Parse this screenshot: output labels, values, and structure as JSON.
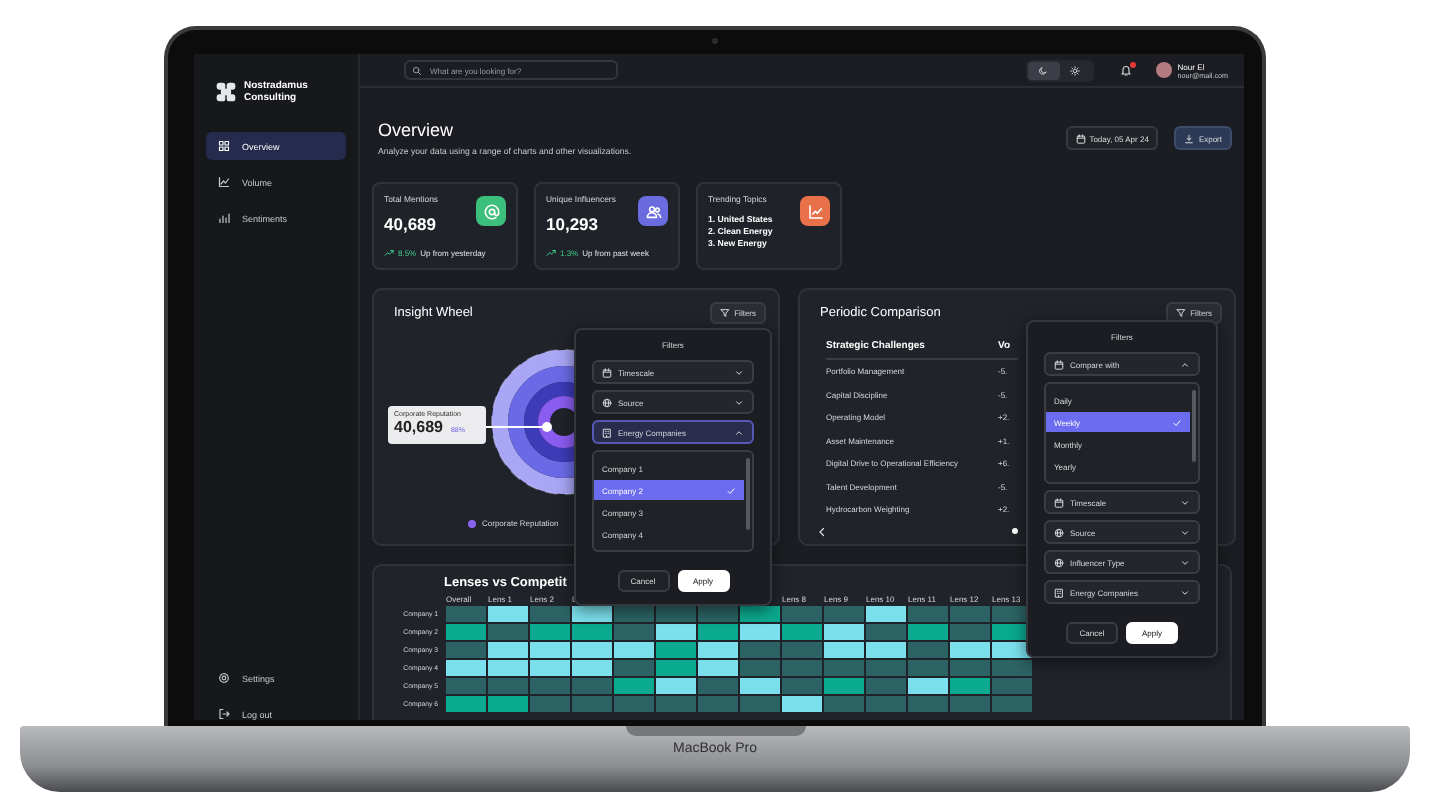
{
  "laptop": {
    "label": "MacBook Pro"
  },
  "sidebar": {
    "brand": [
      "Nostradamus",
      "Consulting"
    ],
    "nav": [
      {
        "label": "Overview",
        "selected": true
      },
      {
        "label": "Volume",
        "selected": false
      },
      {
        "label": "Sentiments",
        "selected": false
      }
    ],
    "footer": [
      {
        "label": "Settings"
      },
      {
        "label": "Log out"
      }
    ]
  },
  "header": {
    "search": {
      "placeholder": "What are you looking for?"
    },
    "theme_toggle": [
      {
        "selected": true
      },
      {
        "selected": false
      }
    ],
    "notification": {
      "unread": true
    },
    "user": {
      "name": "Nour El",
      "email": "nour@mail.com"
    }
  },
  "page": {
    "title": "Overview",
    "subtitle": "Analyze your data using a range of charts and other visualizations.",
    "date_button": "Today, 05 Apr 24",
    "export_button": "Export"
  },
  "stats": [
    {
      "kind": "metric",
      "title": "Total Mentions",
      "value": "40,689",
      "change": "8.5%",
      "note": "Up from yesterday",
      "color": "#3dbf7c"
    },
    {
      "kind": "metric",
      "title": "Unique Influencers",
      "value": "10,293",
      "change": "1.3%",
      "note": "Up from past week",
      "color": "#6b6be0"
    },
    {
      "kind": "list",
      "title": "Trending Topics",
      "items": [
        "1. United States",
        "2. Clean Energy",
        "3. New Energy"
      ],
      "color": "#e8714a"
    }
  ],
  "insight_wheel": {
    "title": "Insight Wheel",
    "filters_button": "Filters",
    "tooltip": {
      "label": "Corporate Reputation",
      "value": "40,689",
      "percent": "88%"
    },
    "legend": [
      {
        "label": "Corporate Reputation",
        "color": "#8b63f0"
      }
    ],
    "filters_popup": {
      "title": "Filters",
      "fields": [
        {
          "kind": "date",
          "label": "Timescale",
          "focused": false,
          "expanded": false
        },
        {
          "kind": "source",
          "label": "Source",
          "focused": false,
          "expanded": false
        },
        {
          "kind": "company",
          "label": "Energy Companies",
          "focused": true,
          "expanded": true,
          "options": [
            {
              "label": "Company 1",
              "selected": false
            },
            {
              "label": "Company 2",
              "selected": true
            },
            {
              "label": "Company 3",
              "selected": false
            },
            {
              "label": "Company 4",
              "selected": false
            }
          ]
        }
      ],
      "cancel": "Cancel",
      "apply": "Apply"
    }
  },
  "periodic_comparison": {
    "title": "Periodic Comparison",
    "filters_button": "Filters",
    "columns": [
      "Strategic Challenges",
      "Vo"
    ],
    "rows": [
      {
        "name": "Portfolio Management",
        "value": "-5."
      },
      {
        "name": "Capital Discipline",
        "value": "-5."
      },
      {
        "name": "Operating Model",
        "value": "+2."
      },
      {
        "name": "Asset Maintenance",
        "value": "+1."
      },
      {
        "name": "Digital Drive to Operational Efficiency",
        "value": "+6."
      },
      {
        "name": "Talent Development",
        "value": "-5."
      },
      {
        "name": "Hydrocarbon Weighting",
        "value": "+2."
      }
    ],
    "filters_popup": {
      "title": "Filters",
      "fields": [
        {
          "kind": "date",
          "label": "Compare with",
          "focused": false,
          "expanded": true,
          "options": [
            {
              "label": "Daily",
              "selected": false
            },
            {
              "label": "Weekly",
              "selected": true
            },
            {
              "label": "Monthly",
              "selected": false
            },
            {
              "label": "Yearly",
              "selected": false
            }
          ]
        },
        {
          "kind": "date",
          "label": "Timescale",
          "focused": false,
          "expanded": false
        },
        {
          "kind": "source",
          "label": "Source",
          "focused": false,
          "expanded": false
        },
        {
          "kind": "source",
          "label": "Influencer Type",
          "focused": false,
          "expanded": false
        },
        {
          "kind": "company",
          "label": "Energy Companies",
          "focused": false,
          "expanded": false
        }
      ],
      "cancel": "Cancel",
      "apply": "Apply"
    }
  },
  "lenses": {
    "title": "Lenses vs Competit",
    "columns": [
      {
        "label": "Overall"
      },
      {
        "label": "Lens 1"
      },
      {
        "label": "Lens 2"
      },
      {
        "label": "L"
      },
      {},
      {},
      {},
      {},
      {
        "label": "Lens 8"
      },
      {
        "label": "Lens 9"
      },
      {
        "label": "Lens 10"
      },
      {
        "label": "Lens 11"
      },
      {
        "label": "Lens 12"
      },
      {
        "label": "Lens 13"
      }
    ],
    "rows": [
      {
        "label": "Company 1",
        "cells": [
          {
            "color": "#2c6364"
          },
          {
            "color": "#7be0ec"
          },
          {
            "color": "#2c6364"
          },
          {
            "color": "#7be0ec"
          },
          {
            "color": "#2c6364"
          },
          {
            "color": "#2c6364"
          },
          {
            "color": "#2c6364"
          },
          {
            "color": "#0aaa90"
          },
          {
            "color": "#2c6364"
          },
          {
            "color": "#2c6364"
          },
          {
            "color": "#7be0ec"
          },
          {
            "color": "#2c6364"
          },
          {
            "color": "#2c6364"
          },
          {
            "color": "#2c6364"
          }
        ]
      },
      {
        "label": "Company 2",
        "cells": [
          {
            "color": "#0aaa90"
          },
          {
            "color": "#2c6364"
          },
          {
            "color": "#0aaa90"
          },
          {
            "color": "#0aaa90"
          },
          {
            "color": "#2c6364"
          },
          {
            "color": "#7be0ec"
          },
          {
            "color": "#0aaa90"
          },
          {
            "color": "#7be0ec"
          },
          {
            "color": "#0aaa90"
          },
          {
            "color": "#7be0ec"
          },
          {
            "color": "#2c6364"
          },
          {
            "color": "#0aaa90"
          },
          {
            "color": "#2c6364"
          },
          {
            "color": "#0aaa90"
          }
        ]
      },
      {
        "label": "Company 3",
        "cells": [
          {
            "color": "#2c6364"
          },
          {
            "color": "#7be0ec"
          },
          {
            "color": "#7be0ec"
          },
          {
            "color": "#7be0ec"
          },
          {
            "color": "#7be0ec"
          },
          {
            "color": "#0aaa90"
          },
          {
            "color": "#7be0ec"
          },
          {
            "color": "#2c6364"
          },
          {
            "color": "#2c6364"
          },
          {
            "color": "#7be0ec"
          },
          {
            "color": "#7be0ec"
          },
          {
            "color": "#2c6364"
          },
          {
            "color": "#7be0ec"
          },
          {
            "color": "#7be0ec"
          }
        ]
      },
      {
        "label": "Company 4",
        "cells": [
          {
            "color": "#7be0ec"
          },
          {
            "color": "#7be0ec"
          },
          {
            "color": "#7be0ec"
          },
          {
            "color": "#7be0ec"
          },
          {
            "color": "#2c6364"
          },
          {
            "color": "#0aaa90"
          },
          {
            "color": "#7be0ec"
          },
          {
            "color": "#2c6364"
          },
          {
            "color": "#2c6364"
          },
          {
            "color": "#2c6364"
          },
          {
            "color": "#2c6364"
          },
          {
            "color": "#2c6364"
          },
          {
            "color": "#2c6364"
          },
          {
            "color": "#2c6364"
          }
        ]
      },
      {
        "label": "Company 5",
        "cells": [
          {
            "color": "#2c6364"
          },
          {
            "color": "#2c6364"
          },
          {
            "color": "#2c6364"
          },
          {
            "color": "#2c6364"
          },
          {
            "color": "#0aaa90"
          },
          {
            "color": "#7be0ec"
          },
          {
            "color": "#2c6364"
          },
          {
            "color": "#7be0ec"
          },
          {
            "color": "#2c6364"
          },
          {
            "color": "#0aaa90"
          },
          {
            "color": "#2c6364"
          },
          {
            "color": "#7be0ec"
          },
          {
            "color": "#0aaa90"
          },
          {
            "color": "#2c6364"
          }
        ]
      },
      {
        "label": "Company 6",
        "cells": [
          {
            "color": "#0aaa90"
          },
          {
            "color": "#0aaa90"
          },
          {
            "color": "#2c6364"
          },
          {
            "color": "#2c6364"
          },
          {
            "color": "#2c6364"
          },
          {
            "color": "#2c6364"
          },
          {
            "color": "#2c6364"
          },
          {
            "color": "#2c6364"
          },
          {
            "color": "#7be0ec"
          },
          {
            "color": "#2c6364"
          },
          {
            "color": "#2c6364"
          },
          {
            "color": "#2c6364"
          },
          {
            "color": "#2c6364"
          },
          {
            "color": "#2c6364"
          }
        ]
      }
    ]
  }
}
